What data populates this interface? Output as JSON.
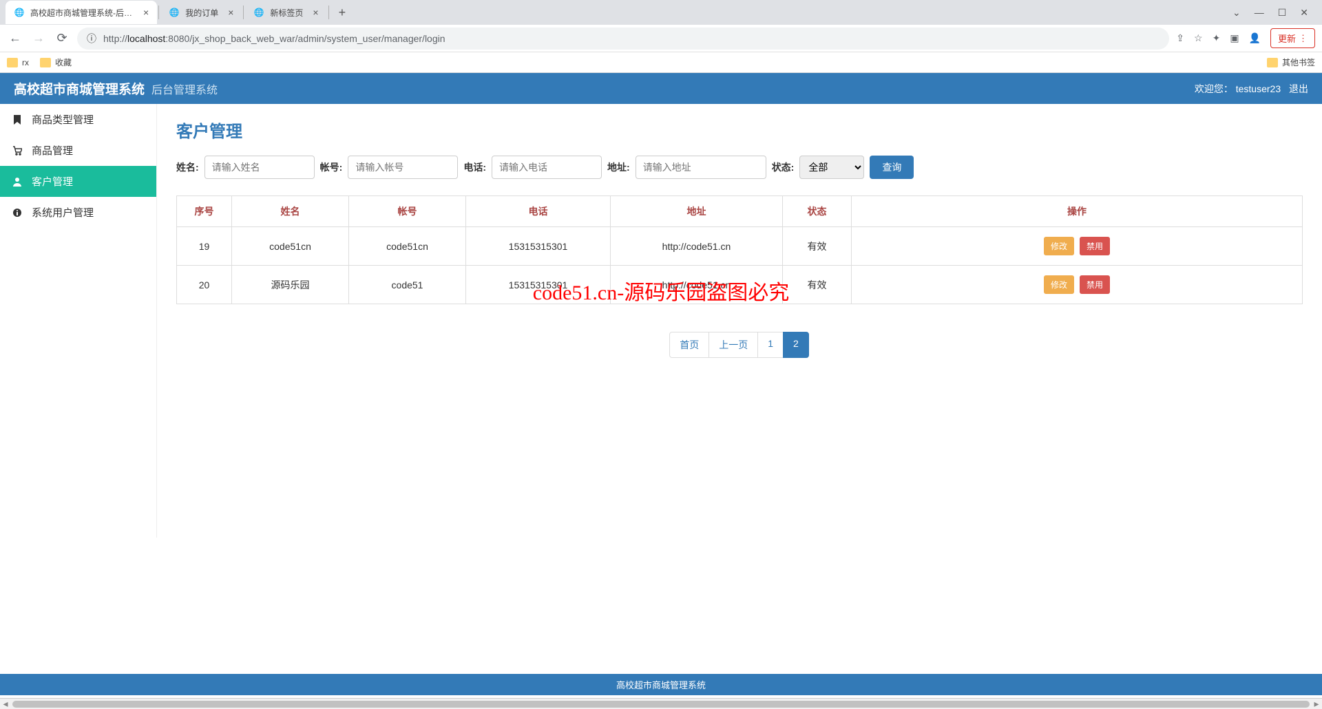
{
  "browser": {
    "tabs": [
      {
        "title": "高校超市商城管理系统-后台管理"
      },
      {
        "title": "我的订单"
      },
      {
        "title": "新标签页"
      }
    ],
    "url_proto": "http://",
    "url_host": "localhost",
    "url_path": ":8080/jx_shop_back_web_war/admin/system_user/manager/login",
    "update_label": "更新",
    "bookmarks": {
      "rx": "rx",
      "favorites": "收藏",
      "other": "其他书签"
    }
  },
  "header": {
    "title": "高校超市商城管理系统",
    "subtitle": "后台管理系统",
    "welcome_prefix": "欢迎您：",
    "username": "testuser23",
    "logout": "退出"
  },
  "sidebar": {
    "items": [
      {
        "label": "商品类型管理"
      },
      {
        "label": "商品管理"
      },
      {
        "label": "客户管理"
      },
      {
        "label": "系统用户管理"
      }
    ]
  },
  "page": {
    "title": "客户管理"
  },
  "filters": {
    "name_label": "姓名:",
    "name_placeholder": "请输入姓名",
    "account_label": "帐号:",
    "account_placeholder": "请输入帐号",
    "phone_label": "电话:",
    "phone_placeholder": "请输入电话",
    "address_label": "地址:",
    "address_placeholder": "请输入地址",
    "status_label": "状态:",
    "status_selected": "全部",
    "search_label": "查询"
  },
  "table": {
    "headers": {
      "seq": "序号",
      "name": "姓名",
      "account": "帐号",
      "phone": "电话",
      "address": "地址",
      "status": "状态",
      "actions": "操作"
    },
    "rows": [
      {
        "seq": "19",
        "name": "code51cn",
        "account": "code51cn",
        "phone": "15315315301",
        "address": "http://code51.cn",
        "status": "有效"
      },
      {
        "seq": "20",
        "name": "源码乐园",
        "account": "code51",
        "phone": "15315315301",
        "address": "http://code51.cn",
        "status": "有效"
      }
    ],
    "edit_label": "修改",
    "disable_label": "禁用"
  },
  "pagination": {
    "first": "首页",
    "prev": "上一页",
    "pages": [
      "1",
      "2"
    ],
    "active": "2"
  },
  "footer": {
    "text": "高校超市商城管理系统"
  },
  "watermark": "code51.cn-源码乐园盗图必究"
}
